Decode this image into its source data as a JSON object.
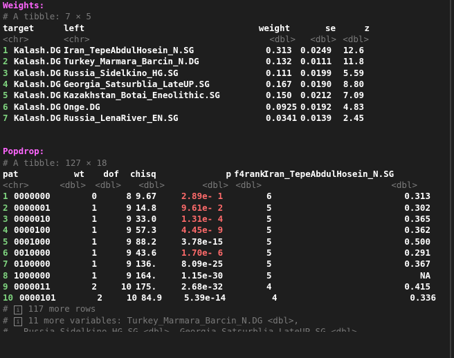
{
  "weights": {
    "title": "Weights:",
    "tibble_info": "# A tibble: 7 × 5",
    "headers": [
      "target",
      "left",
      "weight",
      "se",
      "z"
    ],
    "types": [
      "<chr>",
      "<chr>",
      "<dbl>",
      "<dbl>",
      "<dbl>"
    ],
    "rows": [
      {
        "n": "1",
        "target": "Kalash.DG",
        "left": "Iran_TepeAbdulHosein_N.SG",
        "weight": "0.313",
        "se": "0.0249",
        "z": "12.6"
      },
      {
        "n": "2",
        "target": "Kalash.DG",
        "left": "Turkey_Marmara_Barcin_N.DG",
        "weight": "0.132",
        "se": "0.0111",
        "z": "11.8"
      },
      {
        "n": "3",
        "target": "Kalash.DG",
        "left": "Russia_Sidelkino_HG.SG",
        "weight": "0.111",
        "se": "0.0199",
        "z": "5.59"
      },
      {
        "n": "4",
        "target": "Kalash.DG",
        "left": "Georgia_Satsurblia_LateUP.SG",
        "weight": "0.167",
        "se": "0.0190",
        "z": "8.80"
      },
      {
        "n": "5",
        "target": "Kalash.DG",
        "left": "Kazakhstan_Botai_Eneolithic.SG",
        "weight": "0.150",
        "se": "0.0212",
        "z": "7.09"
      },
      {
        "n": "6",
        "target": "Kalash.DG",
        "left": "Onge.DG",
        "weight": "0.0925",
        "se": "0.0192",
        "z": "4.83"
      },
      {
        "n": "7",
        "target": "Kalash.DG",
        "left": "Russia_LenaRiver_EN.SG",
        "weight": "0.0341",
        "se": "0.0139",
        "z": "2.45"
      }
    ]
  },
  "popdrop": {
    "title": "Popdrop:",
    "tibble_info": "# A tibble: 127 × 18",
    "headers": [
      "pat",
      "wt",
      "dof",
      "chisq",
      "p",
      "f4rank",
      "Iran_TepeAbdulHosein_N.SG"
    ],
    "types": [
      "<chr>",
      "<dbl>",
      "<dbl>",
      "<dbl>",
      "<dbl>",
      "<dbl>",
      "<dbl>"
    ],
    "rows": [
      {
        "n": "1",
        "pat": "0000000",
        "wt": "0",
        "dof": "8",
        "chisq": "9.67",
        "p": "2.89e- 1",
        "p_red": true,
        "f4rank": "6",
        "iran": "0.313"
      },
      {
        "n": "2",
        "pat": "0000001",
        "wt": "1",
        "dof": "9",
        "chisq": "14.8",
        "p": "9.61e- 2",
        "p_red": true,
        "f4rank": "5",
        "iran": "0.302"
      },
      {
        "n": "3",
        "pat": "0000010",
        "wt": "1",
        "dof": "9",
        "chisq": "33.0",
        "p": "1.31e- 4",
        "p_red": true,
        "f4rank": "5",
        "iran": "0.365"
      },
      {
        "n": "4",
        "pat": "0000100",
        "wt": "1",
        "dof": "9",
        "chisq": "57.3",
        "p": "4.45e- 9",
        "p_red": true,
        "f4rank": "5",
        "iran": "0.362"
      },
      {
        "n": "5",
        "pat": "0001000",
        "wt": "1",
        "dof": "9",
        "chisq": "88.2",
        "p": "3.78e-15",
        "p_red": false,
        "f4rank": "5",
        "iran": "0.500"
      },
      {
        "n": "6",
        "pat": "0010000",
        "wt": "1",
        "dof": "9",
        "chisq": "43.6",
        "p": "1.70e- 6",
        "p_red": true,
        "f4rank": "5",
        "iran": "0.291"
      },
      {
        "n": "7",
        "pat": "0100000",
        "wt": "1",
        "dof": "9",
        "chisq": "136.",
        "p": "8.09e-25",
        "p_red": false,
        "f4rank": "5",
        "iran": "0.367"
      },
      {
        "n": "8",
        "pat": "1000000",
        "wt": "1",
        "dof": "9",
        "chisq": "164.",
        "p": "1.15e-30",
        "p_red": false,
        "f4rank": "5",
        "iran": "NA"
      },
      {
        "n": "9",
        "pat": "0000011",
        "wt": "2",
        "dof": "10",
        "chisq": "175.",
        "p": "2.68e-32",
        "p_red": false,
        "f4rank": "4",
        "iran": "0.415"
      },
      {
        "n": "10",
        "pat": "0000101",
        "wt": "2",
        "dof": "10",
        "chisq": "84.9",
        "p": "5.39e-14",
        "p_red": false,
        "f4rank": "4",
        "iran": "0.336"
      }
    ],
    "footer": {
      "more_rows": "117 more rows",
      "more_vars": "11 more variables: Turkey_Marmara_Barcin_N.DG <dbl>,",
      "cut_line": "#   Russia_Sidelkino_HG.SG <dbl>, Georgia_Satsurblia_LateUP.SG <dbl>,"
    }
  }
}
